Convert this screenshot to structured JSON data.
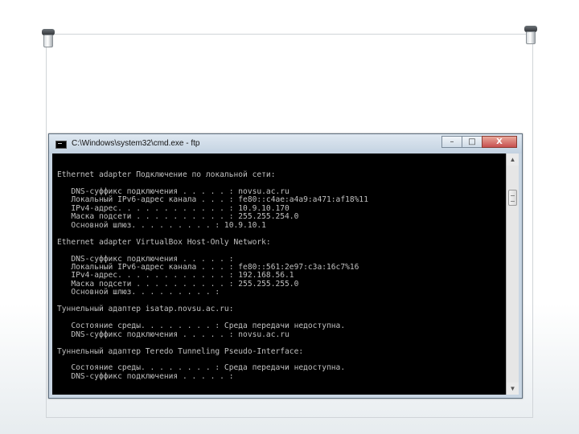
{
  "window": {
    "title": "C:\\Windows\\system32\\cmd.exe - ftp",
    "minimize_label": "–",
    "maximize_label": "□",
    "close_label": "X"
  },
  "console_lines": [
    "Ethernet adapter Подключение по локальной сети:",
    "",
    "   DNS-суффикс подключения . . . . . : novsu.ac.ru",
    "   Локальный IPv6-адрес канала . . . : fe80::c4ae:a4a9:a471:af18%11",
    "   IPv4-адрес. . . . . . . . . . . . : 10.9.10.170",
    "   Маска подсети . . . . . . . . . . : 255.255.254.0",
    "   Основной шлюз. . . . . . . . . : 10.9.10.1",
    "",
    "Ethernet adapter VirtualBox Host-Only Network:",
    "",
    "   DNS-суффикс подключения . . . . . :",
    "   Локальный IPv6-адрес канала . . . : fe80::561:2e97:c3a:16c7%16",
    "   IPv4-адрес. . . . . . . . . . . . : 192.168.56.1",
    "   Маска подсети . . . . . . . . . . : 255.255.255.0",
    "   Основной шлюз. . . . . . . . . :",
    "",
    "Туннельный адаптер isatap.novsu.ac.ru:",
    "",
    "   Состояние среды. . . . . . . . : Среда передачи недоступна.",
    "   DNS-суффикс подключения . . . . . : novsu.ac.ru",
    "",
    "Туннельный адаптер Teredo Tunneling Pseudo-Interface:",
    "",
    "   Состояние среды. . . . . . . . : Среда передачи недоступна.",
    "   DNS-суффикс подключения . . . . . :"
  ],
  "colors": {
    "console_bg": "#000000",
    "console_fg": "#c0c0c0"
  }
}
